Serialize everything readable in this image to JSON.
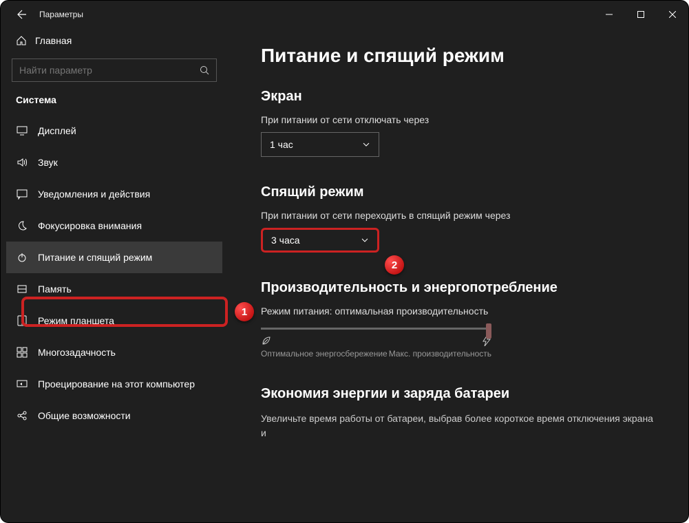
{
  "titlebar": {
    "title": "Параметры"
  },
  "sidebar": {
    "home": "Главная",
    "search_placeholder": "Найти параметр",
    "category": "Система",
    "items": [
      {
        "label": "Дисплей",
        "icon": "display"
      },
      {
        "label": "Звук",
        "icon": "sound"
      },
      {
        "label": "Уведомления и действия",
        "icon": "notify"
      },
      {
        "label": "Фокусировка внимания",
        "icon": "moon"
      },
      {
        "label": "Питание и спящий режим",
        "icon": "power",
        "active": true
      },
      {
        "label": "Память",
        "icon": "storage"
      },
      {
        "label": "Режим планшета",
        "icon": "tablet"
      },
      {
        "label": "Многозадачность",
        "icon": "multitask"
      },
      {
        "label": "Проецирование на этот компьютер",
        "icon": "project"
      },
      {
        "label": "Общие возможности",
        "icon": "shared"
      }
    ]
  },
  "main": {
    "page_title": "Питание и спящий режим",
    "screen": {
      "heading": "Экран",
      "label": "При питании от сети отключать через",
      "value": "1 час"
    },
    "sleep": {
      "heading": "Спящий режим",
      "label": "При питании от сети переходить в спящий режим через",
      "value": "3 часа"
    },
    "perf": {
      "heading": "Производительность и энергопотребление",
      "mode_label": "Режим питания: оптимальная производительность",
      "min": "Оптимальное энергосбережение",
      "max": "Макс. производительность"
    },
    "battery": {
      "heading": "Экономия энергии и заряда батареи",
      "text": "Увеличьте время работы от батареи, выбрав более короткое время отключения экрана и"
    }
  },
  "callouts": {
    "one": "1",
    "two": "2"
  }
}
